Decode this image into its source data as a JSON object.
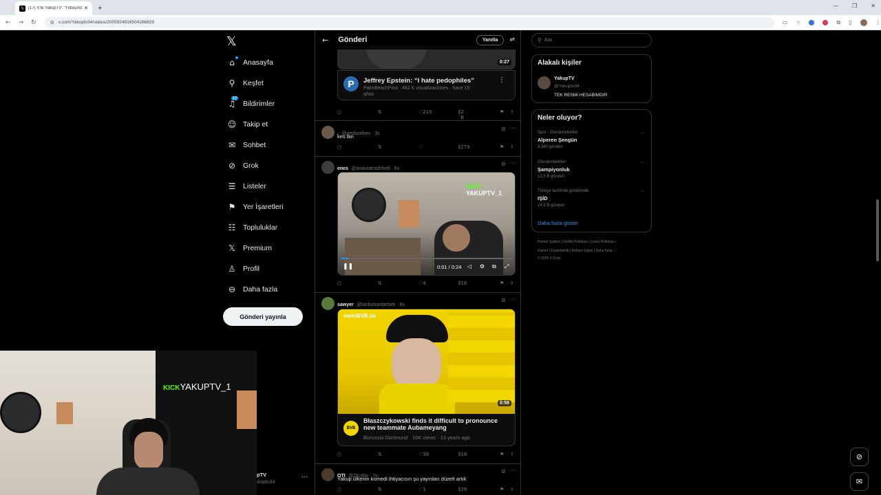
{
  "browser": {
    "tab_title": "(17) X'te YakupTV: \"Yılbaşında ...",
    "tab_icon": "x-icon",
    "url": "x.com/Yakuptv34/status/2005924916504166829",
    "new_tab": "+",
    "win_min": "—",
    "win_max": "❐",
    "win_close": "✕"
  },
  "nav": {
    "items": [
      {
        "label": "Anasayfa",
        "icon": "home-icon"
      },
      {
        "label": "Keşfet",
        "icon": "search-icon"
      },
      {
        "label": "Bildirimler",
        "icon": "bell-icon",
        "badge": "17"
      },
      {
        "label": "Takip et",
        "icon": "follow-icon"
      },
      {
        "label": "Sohbet",
        "icon": "mail-icon"
      },
      {
        "label": "Grok",
        "icon": "grok-icon"
      },
      {
        "label": "Listeler",
        "icon": "list-icon"
      },
      {
        "label": "Yer İşaretleri",
        "icon": "bookmark-icon"
      },
      {
        "label": "Topluluklar",
        "icon": "communities-icon"
      },
      {
        "label": "Premium",
        "icon": "x-premium-icon"
      },
      {
        "label": "Profil",
        "icon": "profile-icon"
      },
      {
        "label": "Daha fazla",
        "icon": "more-circle-icon"
      }
    ],
    "post_button": "Gönderi yayınla",
    "account_name": "pTV",
    "account_handle": "ıkuptv34",
    "account_more": "···"
  },
  "main": {
    "back_icon": "←",
    "title": "Gönderi",
    "reply_button": "Yanıtla",
    "top_video": {
      "duration": "0:27",
      "card_title": "Jeffrey Epstein: “I hate pedophiles”",
      "card_source": "PalmBeachPost · 462 K visualizaciones · hace 15",
      "card_source2": "años",
      "card_logo": "P",
      "actions": {
        "likes": "210",
        "views": "2 B"
      }
    },
    "posts": [
      {
        "name": ".",
        "handle": "@gedsonben · 3s",
        "text": "kes lan",
        "actions": {
          "views": "273"
        }
      },
      {
        "name": "enes",
        "handle": "@anavratrashford · 6s",
        "video": {
          "overlay": "YAKUPTV_1",
          "kick": "KICK",
          "time": "0:01 / 0:24"
        },
        "actions": {
          "likes": "4",
          "views": "18"
        }
      },
      {
        "name": "sawyer",
        "handle": "@lanbulvanbebek · 6s",
        "video": {
          "duration": "0:58",
          "brand": "meinBVB.de",
          "card_title": "Błaszczykowski finds it difficult to pronounce new teammate Aubameyang",
          "card_source": "Borussia Dortmund · 16K views · 13 years ago",
          "card_logo": "BVB"
        },
        "actions": {
          "likes": "38",
          "views": "18"
        }
      },
      {
        "name": "OTI",
        "handle": "@ZKoftw · 7s",
        "text": "Yakup ülkenin komedi ihtiyacısın şu yayınları düzelt artık",
        "actions": {
          "likes": "1",
          "views": "29"
        }
      }
    ]
  },
  "right": {
    "search_placeholder": "Ara",
    "related_title": "Alakalı kişiler",
    "related_person": {
      "name": "YakupTV",
      "handle": "@Yakuptv34",
      "bio": "TEK RESMİ HESABIMDIR"
    },
    "trends_title": "Neler oluyor?",
    "trends": [
      {
        "context": "Spor · Gündemdekiler",
        "name": "Alperen Şengün",
        "count": "3.340 gönderi"
      },
      {
        "context": "Gündemdekiler",
        "name": "Şampiyonluk",
        "count": "13,5 B gönderi"
      },
      {
        "context": "Türkiye tarihinde gündemde",
        "name": "IŞİD",
        "count": "14,9 B gönderi"
      }
    ],
    "show_more": "Daha fazla göster",
    "footer1": "Hizmet Şartları  |  Gizlilik Politikası  |  Çerez Politikası  |",
    "footer2": "Imprint  |  Erişilebilirlik  |  Reklam bilgisi  |  Daha fazla ···",
    "footer3": "© 2025 X Corp."
  },
  "webcam": {
    "overlay_kick": "KICK",
    "overlay_name": "YAKUPTV_1"
  },
  "colors": {
    "accent": "#1d9bf0",
    "kick": "#53fc18",
    "bg": "#000000"
  }
}
